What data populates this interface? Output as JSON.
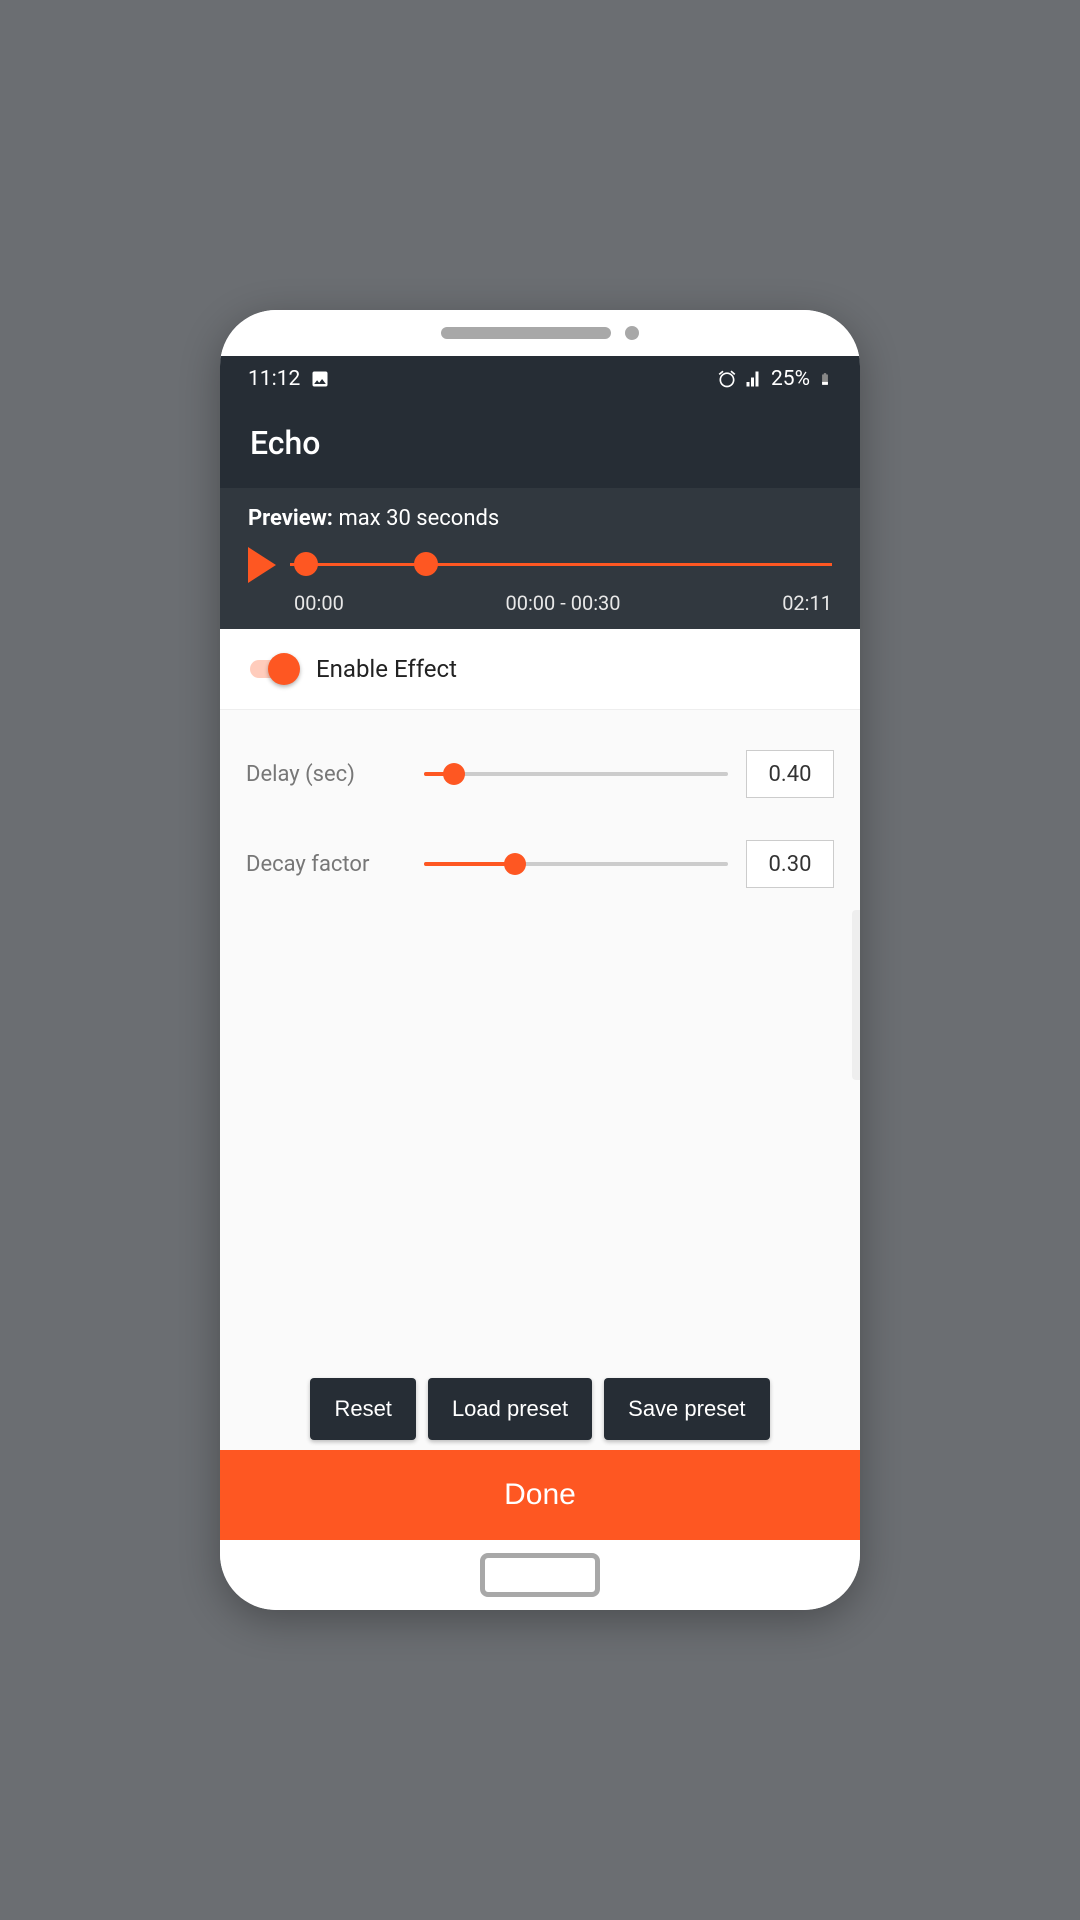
{
  "status": {
    "time": "11:12",
    "battery": "25%"
  },
  "header": {
    "title": "Echo"
  },
  "preview": {
    "label": "Preview:",
    "limit": "max 30 seconds",
    "start_time": "00:00",
    "range": "00:00 - 00:30",
    "end_time": "02:11",
    "handle1_pct": 3,
    "handle2_pct": 25
  },
  "enable": {
    "label": "Enable Effect",
    "on": true
  },
  "controls": [
    {
      "label": "Delay (sec)",
      "value": "0.40",
      "pct": 10
    },
    {
      "label": "Decay factor",
      "value": "0.30",
      "pct": 30
    }
  ],
  "buttons": {
    "reset": "Reset",
    "load": "Load preset",
    "save": "Save preset",
    "done": "Done"
  }
}
